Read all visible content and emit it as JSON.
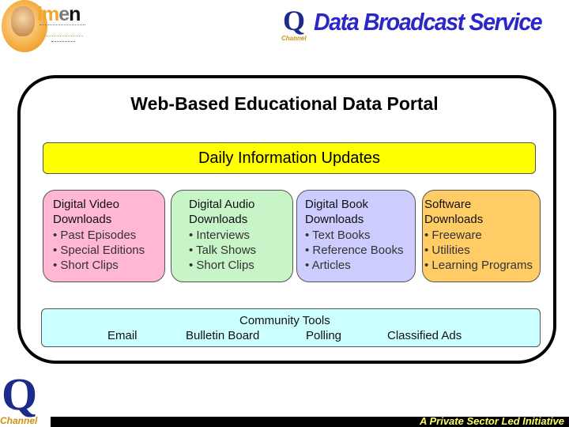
{
  "header": {
    "left_logo": {
      "name": "imen",
      "letters": [
        "i",
        "m",
        "e",
        "n"
      ]
    },
    "q_logo": {
      "letter": "Q",
      "caption": "Channel"
    },
    "title": "Data Broadcast Service"
  },
  "portal": {
    "title": "Web-Based Educational Data Portal",
    "daily_bar": "Daily Information Updates",
    "cards": [
      {
        "heading1": "Digital Video",
        "heading2": "Downloads",
        "items": [
          "Past Episodes",
          "Special Editions",
          "Short Clips"
        ],
        "color": "#ffb7d3"
      },
      {
        "heading1": "Digital Audio",
        "heading2": "Downloads",
        "items": [
          "Interviews",
          "Talk Shows",
          "Short Clips"
        ],
        "color": "#c8f5c8"
      },
      {
        "heading1": "Digital Book",
        "heading2": "Downloads",
        "items": [
          "Text Books",
          "Reference Books",
          "Articles"
        ],
        "color": "#ccccff"
      },
      {
        "heading1": "Software",
        "heading2": "Downloads",
        "items": [
          "Freeware",
          "Utilities",
          "Learning Programs"
        ],
        "color": "#ffcc66"
      }
    ],
    "community": {
      "title": "Community Tools",
      "items": [
        "Email",
        "Bulletin Board",
        "Polling",
        "Classified Ads"
      ]
    }
  },
  "footer": {
    "q_logo": {
      "letter": "Q",
      "caption": "Channel"
    },
    "tagline": "A Private Sector Led Initiative"
  },
  "colors": {
    "title_blue": "#2a26c8",
    "daily_bar": "#ffff00",
    "community": "#ccffff",
    "footer_text": "#ffff66"
  }
}
